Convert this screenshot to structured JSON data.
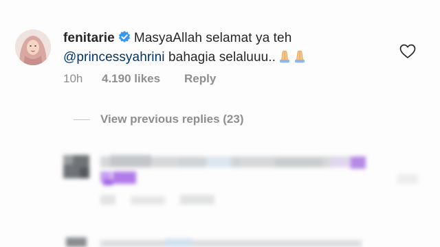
{
  "comment": {
    "username": "fenitarie",
    "text_part1": "MasyaAllah selamat ya teh",
    "mention": "@princessyahrini",
    "text_part2": "bahagia selaluuu..",
    "emoji": "🙏🙏",
    "time": "10h",
    "likes": "4.190 likes",
    "reply_label": "Reply"
  },
  "view_replies": {
    "label": "View previous replies (23)"
  },
  "icons": {
    "verified": "verified-badge-icon",
    "like": "heart-icon"
  },
  "colors": {
    "text": "#262626",
    "muted": "#8e8e8e",
    "mention": "#003569",
    "verified_blue": "#3897f0"
  }
}
